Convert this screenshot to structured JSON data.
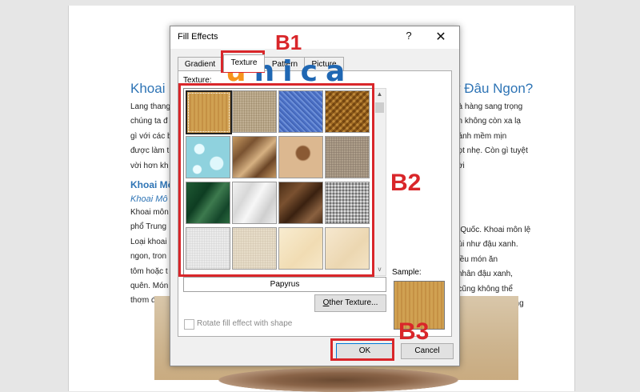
{
  "document": {
    "left_heading": "Khoai",
    "right_heading": "ý Đâu Ngon?",
    "left_lines": [
      "Lang thang",
      "chúng ta đ",
      "gì với các b",
      "được làm t",
      "vời hơn kh"
    ],
    "right_lines_1": [
      "hà hàng sang trọng",
      "ăn không còn xa lạ",
      "bánh mềm mịn",
      "gọt nhẹ. Còn gì tuyệt",
      ""
    ],
    "left_subheading": "Khoai Mô",
    "left_subheading2": "Khoai Mô",
    "left_lines_2": [
      "Khoai môn",
      "phổ Trung",
      "Loại khoai",
      "ngon, tron",
      "tôm hoặc t",
      "quên. Món",
      "thơm đặc"
    ],
    "right_lines_2": [
      "g Quốc. Khoai môn lệ",
      "bùi như đậu xanh.",
      "hiều món ăn",
      "i nhân đậu xanh,",
      "ì cũng không thể",
      "nh vị bở bùi, hương",
      ""
    ]
  },
  "dialog": {
    "title": "Fill Effects",
    "help": "?",
    "close": "✕",
    "tabs": [
      "Gradient",
      "Texture",
      "Pattern",
      "Picture"
    ],
    "active_tab": "Texture",
    "texture_label": "Texture:",
    "selected_texture_name": "Papyrus",
    "other_texture_label_pre": "O",
    "other_texture_label": "ther Texture...",
    "rotate_label": "Rotate fill effect with shape",
    "rotate_checked": false,
    "sample_label": "Sample:",
    "ok_label": "OK",
    "cancel_label": "Cancel",
    "scroll_up": "▲",
    "scroll_down": "v"
  },
  "annotations": {
    "b1": "B1",
    "b2": "B2",
    "b3": "B3",
    "color": "#d9262a"
  },
  "logo": {
    "text_u": "u",
    "text_rest": "nica",
    "color_main": "#1f67b3",
    "color_u": "#f7941d"
  }
}
